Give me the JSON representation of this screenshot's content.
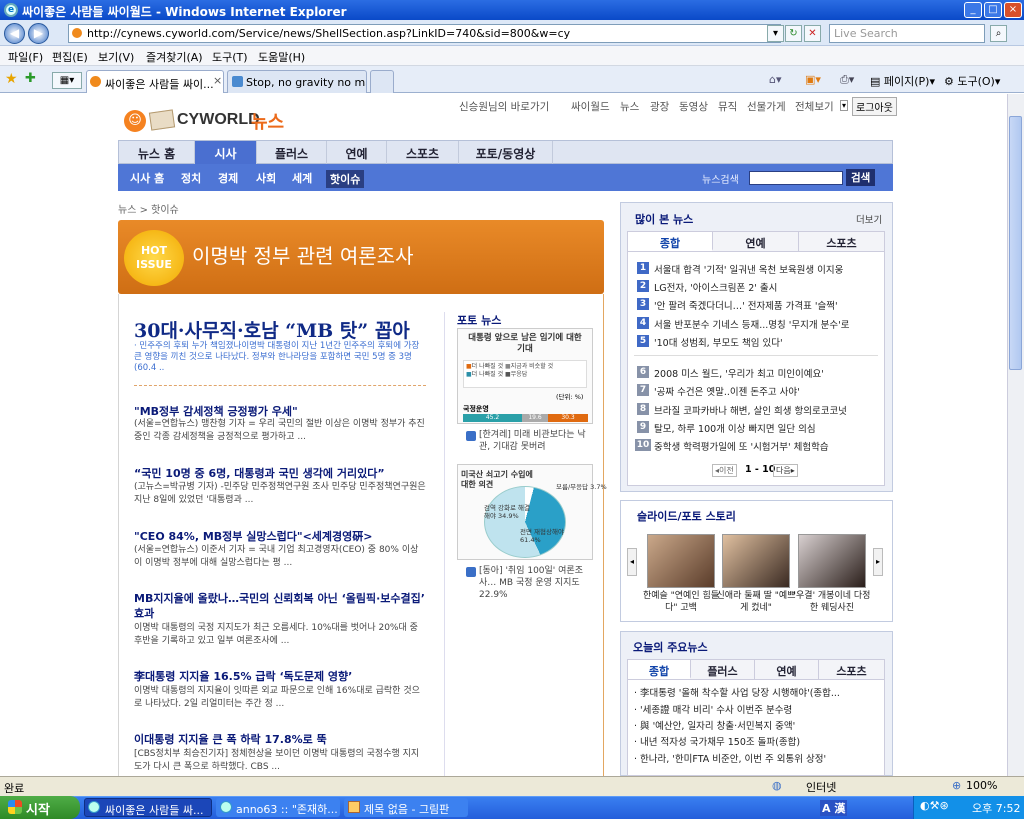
{
  "window": {
    "title": "싸이좋은 사람들 싸이월드 - Windows Internet Explorer",
    "minimize": "_",
    "maximize": "□",
    "close": "×"
  },
  "toolbar": {
    "url": "http://cynews.cyworld.com/Service/news/ShellSection.asp?LinkID=740&sid=800&w=cy",
    "search_placeholder": "Live Search",
    "back": "◀",
    "forward": "▶",
    "refresh": "↻",
    "stop": "✕"
  },
  "menu": [
    "파일(F)",
    "편집(E)",
    "보기(V)",
    "즐겨찾기(A)",
    "도구(T)",
    "도움말(H)"
  ],
  "tabs": [
    {
      "label": "싸이좋은 사람들 싸이...",
      "close": "×"
    },
    {
      "label": "Stop, no gravity no matt..."
    }
  ],
  "command_bar": {
    "page": "페이지(P)",
    "tools": "도구(O)"
  },
  "site": {
    "logo_text": "CYWORLD",
    "logo_news": "뉴스",
    "top_links": [
      "신승원님의 바로가기",
      "싸이월드",
      "뉴스",
      "광장",
      "동영상",
      "뮤직",
      "선물가게",
      "전체보기"
    ],
    "logout": "로그아웃",
    "main_nav": [
      "뉴스 홈",
      "시사",
      "플러스",
      "연예",
      "스포츠",
      "포토/동영상"
    ],
    "sub_nav": [
      "시사 홈",
      "정치",
      "경제",
      "사회",
      "세계",
      "핫이슈"
    ],
    "news_search_label": "뉴스검색",
    "news_search_button": "검색",
    "breadcrumb": "뉴스 > 핫이슈"
  },
  "hot_issue": {
    "badge_line1": "HOT",
    "badge_line2": "ISSUE",
    "title": "이명박 정부 관련 여론조사"
  },
  "headline": {
    "title": "30대·사무직·호남 “MB 탓” 꼽아",
    "lead": "· 민주주의 후퇴 누가 책임졌나이명박 대통령이 지난 1년간 민주주의 후퇴에 가장 큰 영향을 끼친 것으로 나타났다. 정부와 한나라당을 포함하면 국민 5명 중 3명(60.4 .."
  },
  "articles": [
    {
      "title": "\"MB정부 감세정책 긍정평가 우세\"",
      "body": "(서울=연합뉴스) 맹찬형 기자 = 우리 국민의 절반 이상은 이명박 정부가 추진중인 각종 감세정책을 긍정적으로 평가하고 ..."
    },
    {
      "title": "“국민 10명 중 6명, 대통령과 국민 생각에 거리있다”",
      "body": "(고뉴스=박규병 기자) -민주당 민주정책연구원 조사 민주당 민주정책연구원은 지난 8일에 있었던 '대통령과 ..."
    },
    {
      "title": "\"CEO 84%, MB정부 실망스럽다\"<세계경영硏>",
      "body": "(서울=연합뉴스) 이준서 기자 = 국내 기업 최고경영자(CEO) 중 80% 이상이 이명박 정부에 대해 실망스럽다는 평 ..."
    },
    {
      "title": "MB지지율에 올랐나…국민의 신뢰회복 아닌 ‘올림픽·보수결집’ 효과",
      "body": "이명박 대통령의 국정 지지도가 최근 오름세다. 10%대를 벗어나 20%대 중 후반을 기록하고 있고 일부 여론조사에 ..."
    },
    {
      "title": "李대통령 지지율 16.5% 급락 ‘독도문제 영향’",
      "body": "이명박 대통령의 지지율이 잇따른 외교 파문으로 인해 16%대로 급락한 것으로 나타났다. 2일 리얼미터는 주간 정 ..."
    },
    {
      "title": "이대통령 지지율 큰 폭 하락 17.8%로 뚝",
      "body": "[CBS정치부 최승진기자] 정체현상을 보이던 이명박 대통령의 국정수행 지지도가 다시 큰 폭으로 하락했다. CBS ..."
    }
  ],
  "photo_news": {
    "heading": "포토 뉴스",
    "items": [
      {
        "graph_title": "대통령 앞으로 남은 임기에 대한 기대",
        "legend": [
          "더 나빠질 것",
          "지금과 비슷할 것",
          "더 나빠질 것",
          "무응답"
        ],
        "unit": "(단위: %)",
        "row_label": "국정운영",
        "values": [
          "45.2",
          "19.6",
          "30.3"
        ],
        "caption": "[한겨레] 미래 비관보다는 낙관, 기대감 못버려"
      },
      {
        "graph_title": "미국산 쇠고기 수입에 대한 의견",
        "labels": [
          "모름/무응답 3.7%",
          "검역 강화로 해결해야 34.9%",
          "전면 재협상해야 61.4%"
        ],
        "caption": "[동아] '취임 100일' 여론조사… MB 국정 운영 지지도 22.9%"
      }
    ]
  },
  "most_viewed": {
    "heading": "많이 본 뉴스",
    "more": "더보기",
    "tabs": [
      "종합",
      "연예",
      "스포츠"
    ],
    "items": [
      "서울대 합격 '기적' 일궈낸 옥천 보육원생 이지웅",
      "LG전자, '아이스크림폰 2' 출시",
      "'안 팔려 죽겠다더니…' 전자제품 가격표 '슬쩍'",
      "서울 반포분수 기네스 등재...명칭 '무지개 분수'로",
      "'10대 성범죄, 부모도 책임 있다'",
      "2008 미스 월드, '우리가 최고 미인이예요'",
      "'공짜 수건은 옛말..이젠 돈주고 사야'",
      "브라질 코파카바나 해변, 살인 희생 항의로코코넛",
      "탈모, 하루 100개 이상 빠지면 일단 의심",
      "중학생 학력평가일에 또 '시험거부' 체험학습"
    ],
    "numbers": [
      "1",
      "2",
      "3",
      "4",
      "5",
      "6",
      "7",
      "8",
      "9",
      "10"
    ],
    "pager_prev": "◂이전",
    "pager_range": "1 - 10",
    "pager_next": "다음▸"
  },
  "slide_story": {
    "heading": "슬라이드/포토 스토리",
    "items": [
      {
        "caption": "한예슬 \"연예인 힘들다\" 고백"
      },
      {
        "caption": "신애라 둘째 딸 \"예쁘게 컸네\""
      },
      {
        "caption": "'우결' 개봉이네 다정한 웨딩사진"
      }
    ],
    "prev": "◂",
    "next": "▸"
  },
  "today_news": {
    "heading": "오늘의 주요뉴스",
    "tabs": [
      "종합",
      "플러스",
      "연예",
      "스포츠"
    ],
    "items": [
      "李대통령 '올해 착수할 사업 당장 시행해야'(종합...",
      "'세종證 매각 비리' 수사 이번주 분수령",
      "與 '예산안, 일자리 창출·서민복지 중액'",
      "내년 적자성 국가채무 150조 돌파(종합)",
      "한나라, '한미FTA 비준안, 이번 주 외통위 상정'"
    ]
  },
  "statusbar": {
    "text": "완료",
    "zone": "인터넷",
    "zoom": "100%"
  },
  "taskbar": {
    "start": "시작",
    "tasks": [
      "싸이좋은 사람들 싸...",
      "anno63 :: \"존재하...",
      "제목 없음 - 그림판"
    ],
    "clock": "오후 7:52",
    "ime": "A 漢"
  },
  "colors": {
    "accent": "#4f76d6",
    "hot": "#e98a28",
    "link": "#0a1a78"
  }
}
